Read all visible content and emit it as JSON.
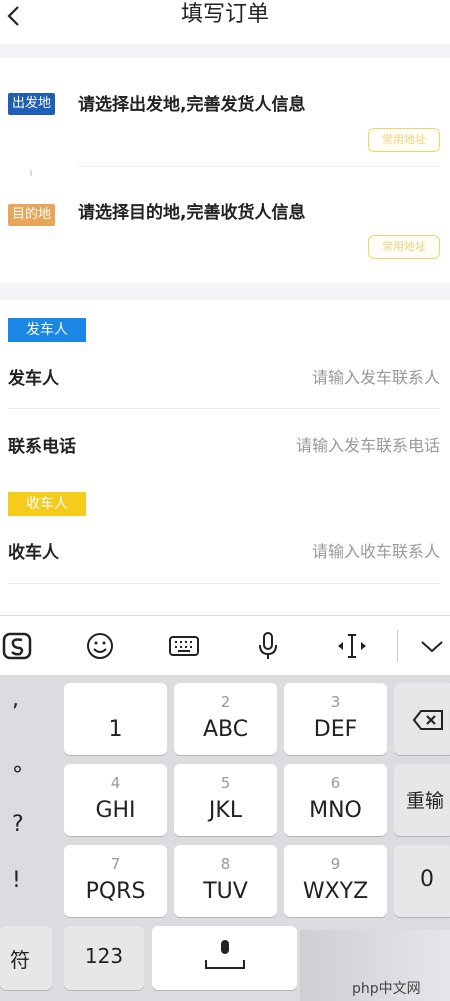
{
  "header": {
    "title": "填写订单"
  },
  "addresses": {
    "origin": {
      "badge": "出发地",
      "text": "请选择出发地,完善发货人信息",
      "chip": "常用地址"
    },
    "destination": {
      "badge": "目的地",
      "text": "请选择目的地,完善收货人信息",
      "chip": "常用地址"
    }
  },
  "sender": {
    "tag": "发车人",
    "rows": [
      {
        "label": "发车人",
        "placeholder": "请输入发车联系人"
      },
      {
        "label": "联系电话",
        "placeholder": "请输入发车联系电话"
      }
    ]
  },
  "receiver": {
    "tag": "收车人",
    "rows": [
      {
        "label": "收车人",
        "placeholder": "请输入收车联系人"
      }
    ]
  },
  "keyboard": {
    "left_symbols": [
      ",",
      "°",
      "?",
      "!"
    ],
    "keys": [
      {
        "num": "",
        "main": "1"
      },
      {
        "num": "2",
        "main": "ABC"
      },
      {
        "num": "3",
        "main": "DEF"
      },
      {
        "num": "4",
        "main": "GHI"
      },
      {
        "num": "5",
        "main": "JKL"
      },
      {
        "num": "6",
        "main": "MNO"
      },
      {
        "num": "7",
        "main": "PQRS"
      },
      {
        "num": "8",
        "main": "TUV"
      },
      {
        "num": "9",
        "main": "WXYZ"
      }
    ],
    "reenter": "重输",
    "zero": "0",
    "symbol": "符",
    "num123": "123"
  },
  "watermark": "php中文网"
}
